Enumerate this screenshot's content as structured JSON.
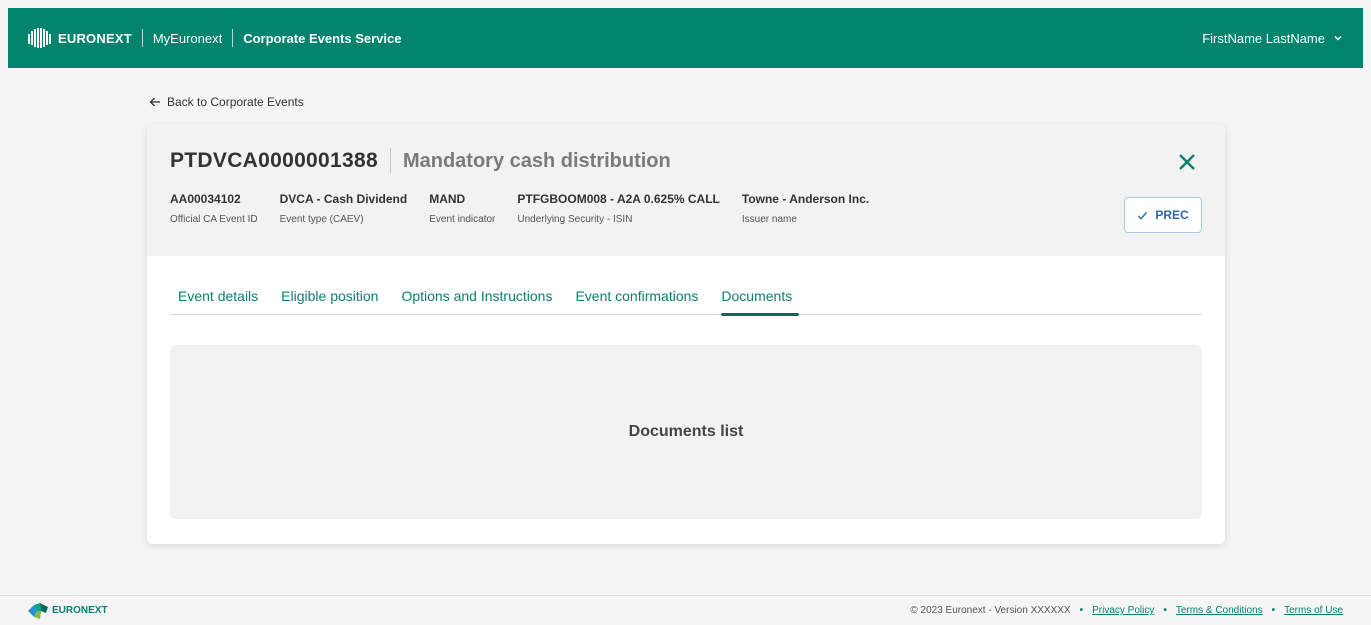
{
  "header": {
    "brand": "EURONEXT",
    "link": "MyEuronext",
    "service": "Corporate Events Service",
    "user": "FirstName LastName"
  },
  "back_link": "Back to Corporate Events",
  "event": {
    "id": "PTDVCA0000001388",
    "title": "Mandatory cash distribution",
    "meta": [
      {
        "value": "AA00034102",
        "label": "Official CA Event ID"
      },
      {
        "value": "DVCA - Cash Dividend",
        "label": "Event type (CAEV)"
      },
      {
        "value": "MAND",
        "label": "Event indicator"
      },
      {
        "value": "PTFGBOOM008 - A2A 0.625% CALL",
        "label": "Underlying Security - ISIN"
      },
      {
        "value": "Towne - Anderson Inc.",
        "label": "Issuer name"
      }
    ],
    "status_button": "PREC"
  },
  "tabs": [
    {
      "label": "Event details",
      "active": false
    },
    {
      "label": "Eligible position",
      "active": false
    },
    {
      "label": "Options and Instructions",
      "active": false
    },
    {
      "label": "Event confirmations",
      "active": false
    },
    {
      "label": "Documents",
      "active": true
    }
  ],
  "documents_panel": "Documents list",
  "footer": {
    "brand": "EURONEXT",
    "copyright": "© 2023 Euronext - Version XXXXXX",
    "links": [
      "Privacy Policy",
      "Terms & Conditions",
      "Terms of Use"
    ]
  },
  "colors": {
    "brand": "#00846e",
    "accent_text": "#0b7f6d",
    "status_button": "#2b6aa8"
  }
}
